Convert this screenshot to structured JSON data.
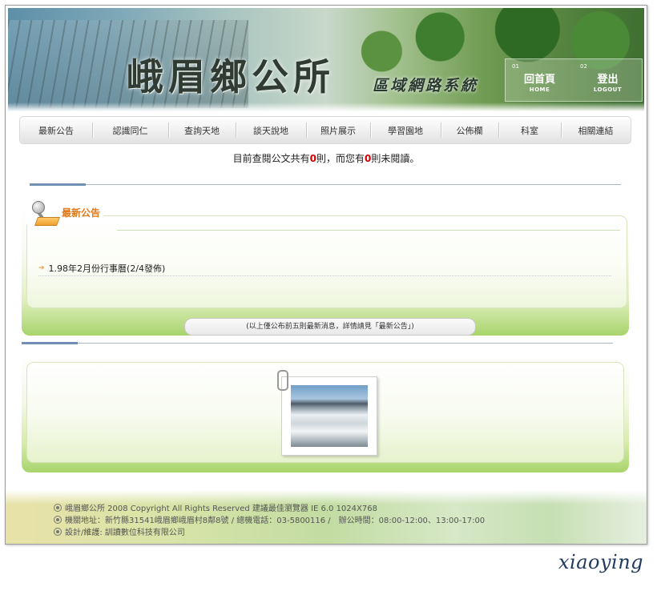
{
  "banner": {
    "title": "峨眉鄉公所",
    "subtitle": "區域網路系統",
    "home_zh": "回首頁",
    "home_en": "HOME",
    "home_dot": "01",
    "logout_zh": "登出",
    "logout_en": "LOGOUT",
    "logout_dot": "02"
  },
  "nav": {
    "items": [
      {
        "label": "最新公告"
      },
      {
        "label": "認識同仁"
      },
      {
        "label": "查詢天地"
      },
      {
        "label": "談天說地"
      },
      {
        "label": "照片展示"
      },
      {
        "label": "學習園地"
      },
      {
        "label": "公佈欄"
      },
      {
        "label": "科室"
      },
      {
        "label": "相關連結"
      }
    ]
  },
  "notice": {
    "prefix": "目前查閱公文共有",
    "count1": "0",
    "middle": "則，而您有",
    "count2": "0",
    "suffix": "則未閱讀。"
  },
  "news": {
    "title": "最新公告",
    "items": [
      {
        "text": "1.98年2月份行事曆(2/4發佈)"
      }
    ],
    "more": "(以上僅公布前五則最新消息，詳情請見「最新公告」)"
  },
  "footer": {
    "line1": "峨眉鄉公所 2008 Copyright All Rights Reserved 建議最佳瀏覽器 IE 6.0 1024X768",
    "line2": "機關地址：新竹縣31541峨眉鄉峨眉村8鄰8號 / 總機電話：03-5800116 /　辦公時間：08:00-12:00、13:00-17:00",
    "line3": "設計/維護: 訓讀數位科技有限公司"
  },
  "signature": "xiaoying"
}
